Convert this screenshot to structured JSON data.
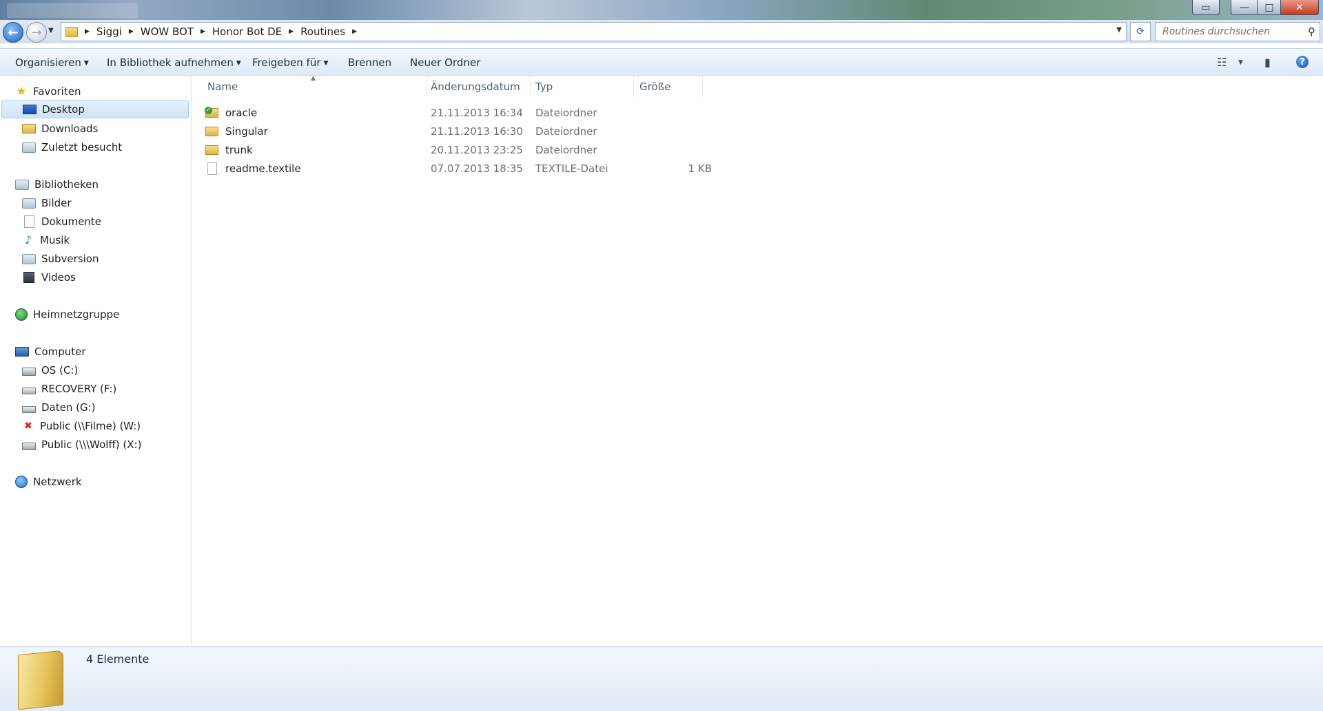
{
  "window": {
    "close_glyph": "✕",
    "max_glyph": "□",
    "min_glyph": "—"
  },
  "address": {
    "crumbs": [
      "Siggi",
      "WOW BOT",
      "Honor Bot DE",
      "Routines"
    ],
    "search_placeholder": "Routines durchsuchen"
  },
  "toolbar": {
    "organize": "Organisieren",
    "add_to_library": "In Bibliothek aufnehmen",
    "share_with": "Freigeben für",
    "burn": "Brennen",
    "new_folder": "Neuer Ordner",
    "help": "?"
  },
  "sidebar": {
    "favorites": "Favoriten",
    "fav_items": [
      "Desktop",
      "Downloads",
      "Zuletzt besucht"
    ],
    "libraries": "Bibliotheken",
    "lib_items": [
      "Bilder",
      "Dokumente",
      "Musik",
      "Subversion",
      "Videos"
    ],
    "homegroup": "Heimnetzgruppe",
    "computer": "Computer",
    "drives": [
      "OS (C:)",
      "RECOVERY (F:)",
      "Daten (G:)",
      "Public (\\\\Filme) (W:)",
      "Public (\\\\\\Wolff) (X:)"
    ],
    "network": "Netzwerk"
  },
  "filelist": {
    "columns": [
      "Name",
      "Änderungsdatum",
      "Typ",
      "Größe"
    ],
    "rows": [
      {
        "name": "oracle",
        "date": "21.11.2013 16:34",
        "type": "Dateiordner",
        "size": ""
      },
      {
        "name": "Singular",
        "date": "21.11.2013 16:30",
        "type": "Dateiordner",
        "size": ""
      },
      {
        "name": "trunk",
        "date": "20.11.2013 23:25",
        "type": "Dateiordner",
        "size": ""
      },
      {
        "name": "readme.textile",
        "date": "07.07.2013 18:35",
        "type": "TEXTILE-Datei",
        "size": "1 KB"
      }
    ]
  },
  "details": {
    "count": "4 Elemente"
  },
  "colors": {
    "accent": "#1d63b8",
    "selection": "#cfe3f7",
    "header_text": "#4c607a"
  }
}
